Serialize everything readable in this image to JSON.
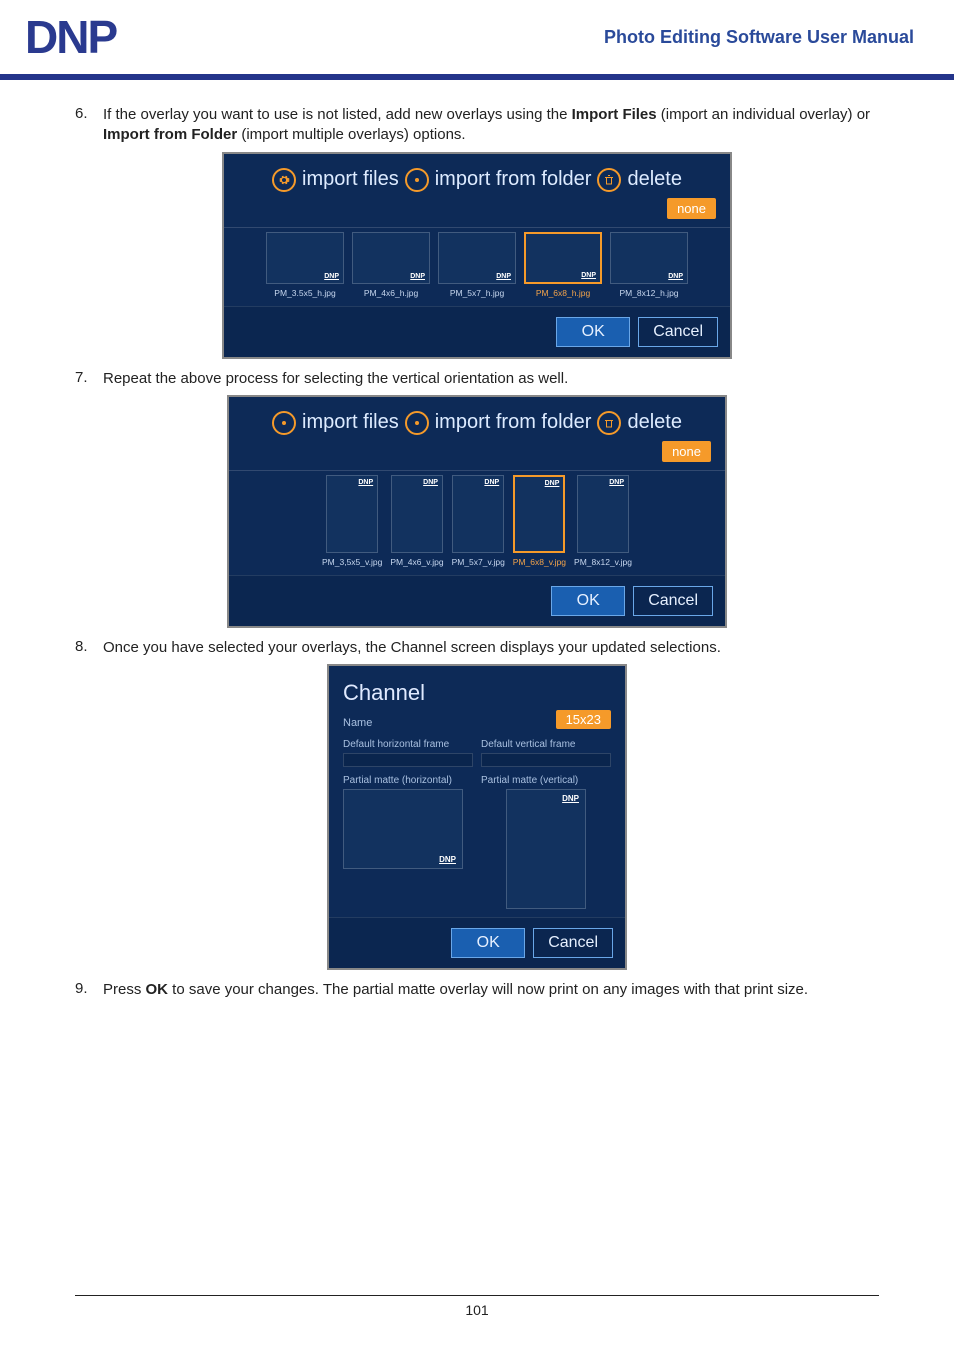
{
  "header": {
    "logo": "DNP",
    "title": "Photo Editing Software User Manual"
  },
  "steps": {
    "s6": {
      "num": "6.",
      "text_a": "If the overlay you want to use is not listed, add new overlays using the ",
      "b1": "Import Files",
      "text_b": " (import an individual overlay) or ",
      "b2": "Import from Folder",
      "text_c": " (import multiple overlays) options."
    },
    "s7": {
      "num": "7.",
      "text": "Repeat the above process for selecting the vertical orientation as well."
    },
    "s8": {
      "num": "8.",
      "text": "Once you have selected your overlays, the Channel screen displays your updated selections."
    },
    "s9": {
      "num": "9.",
      "text_a": "Press ",
      "b1": "OK",
      "text_b": " to save your changes. The partial matte overlay will now print on any images with that print size."
    }
  },
  "dlg": {
    "import_files": "import files",
    "import_folder": "import from folder",
    "delete": "delete",
    "none": "none",
    "ok": "OK",
    "cancel": "Cancel",
    "thumbs_h": [
      {
        "name": "PM_3.5x5_h.jpg",
        "on": false
      },
      {
        "name": "PM_4x6_h.jpg",
        "on": false
      },
      {
        "name": "PM_5x7_h.jpg",
        "on": false
      },
      {
        "name": "PM_6x8_h.jpg",
        "on": true
      },
      {
        "name": "PM_8x12_h.jpg",
        "on": false
      }
    ],
    "thumbs_v": [
      {
        "name": "PM_3,5x5_v.jpg",
        "on": false
      },
      {
        "name": "PM_4x6_v.jpg",
        "on": false
      },
      {
        "name": "PM_5x7_v.jpg",
        "on": false
      },
      {
        "name": "PM_6x8_v.jpg",
        "on": true
      },
      {
        "name": "PM_8x12_v.jpg",
        "on": false
      }
    ],
    "dnp_tag": "DNP"
  },
  "channel": {
    "title": "Channel",
    "name_lbl": "Name",
    "name_val": "15x23",
    "dhf": "Default horizontal frame",
    "dvf": "Default vertical frame",
    "pmh": "Partial matte (horizontal)",
    "pmv": "Partial matte (vertical)",
    "dnp_tag": "DNP"
  },
  "footer": {
    "page": "101"
  }
}
